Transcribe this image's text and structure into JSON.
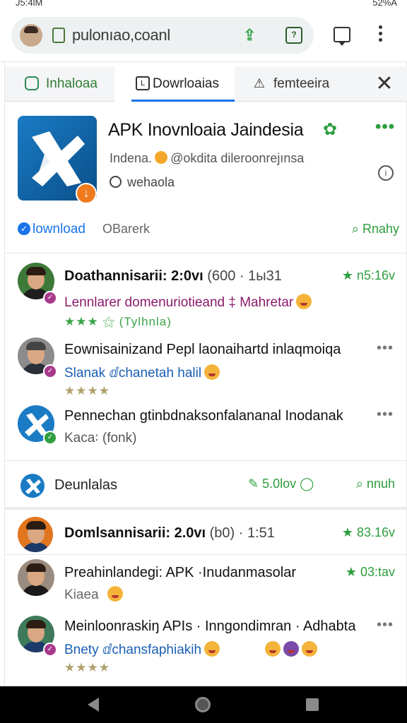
{
  "status": {
    "time": "J5:4lM",
    "right": "52%A"
  },
  "browser": {
    "url": "pulonıao,coanl"
  },
  "tabs": [
    {
      "label": "Inhaloaa"
    },
    {
      "label": "Dowrloaias"
    },
    {
      "label": "femteeira"
    }
  ],
  "app": {
    "title": "APK Inovnloaia Jaindesia",
    "subtitle_pre": "Indena.",
    "subtitle_post": "@okdita dileroonrejınsa",
    "subtitle2": "wehaola",
    "download_label": "lownload",
    "bar_label": "OBarerk",
    "rank_label": "Rnahy"
  },
  "feed": [
    {
      "title": "Doathannisarii: 2:0vı",
      "meta": "(600 · 1ы31",
      "time": "★ n5:16v",
      "sub": "Lennlarer domenuriotieand ‡ Mahretar",
      "stars": "★★★ ⚝ (Tylhnla)"
    },
    {
      "title": "Eownisainizand Pepl laonaihartd inlaqmoiqa",
      "sub": "Slanak ⅆchanetah halil",
      "stars": "★★★★"
    },
    {
      "title": "Pennechan gtinbdnaksonfalananal Inodanak",
      "sub": "Kaca꞉ (fonk)"
    }
  ],
  "downloads_bar": {
    "label": "Deunlalas",
    "stat": "5.0lov",
    "rank": "nnuh"
  },
  "feed2": [
    {
      "title": "Domlsannisarii: 2.0vı",
      "meta": "(b0) · 1:51",
      "time": "★ 83.16v"
    },
    {
      "title": "Preahinlandegi: APK ·Inudanmasolar",
      "sub": "Kiaea",
      "time": "★ 03:tav"
    },
    {
      "title": "Meinloonraskiŋ APIs · Inngondimran · Adhabta",
      "sub": "Bnety ⅆchansfaphiakih",
      "stars": "★★★★"
    }
  ],
  "colors": {
    "accent": "#1a73e8",
    "green": "#2e9e3e",
    "orange": "#ef7b1e"
  }
}
